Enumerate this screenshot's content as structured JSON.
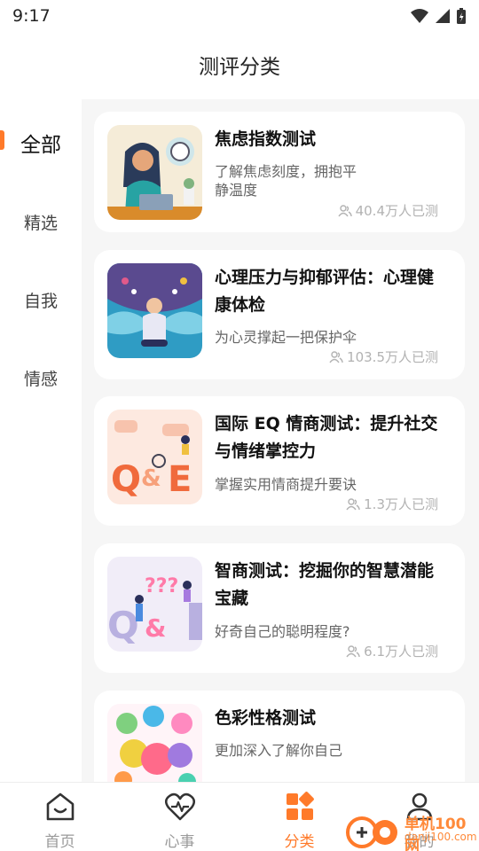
{
  "status_bar": {
    "time": "9:17"
  },
  "header": {
    "title": "测评分类"
  },
  "sidebar": {
    "items": [
      {
        "label": "全部"
      },
      {
        "label": "精选"
      },
      {
        "label": "自我"
      },
      {
        "label": "情感"
      }
    ]
  },
  "cards": [
    {
      "title": "焦虑指数测试",
      "desc": "了解焦虑刻度，拥抱平静温度",
      "count": "40.4万人已测"
    },
    {
      "title": "心理压力与抑郁评估：心理健康体检",
      "desc": "为心灵撑起一把保护伞",
      "count": "103.5万人已测"
    },
    {
      "title": "国际 EQ 情商测试：提升社交与情绪掌控力",
      "desc": "掌握实用情商提升要诀",
      "count": "1.3万人已测"
    },
    {
      "title": "智商测试：挖掘你的智慧潜能宝藏",
      "desc": "好奇自己的聪明程度?",
      "count": "6.1万人已测"
    },
    {
      "title": "色彩性格测试",
      "desc": "更加深入了解你自己",
      "count": ""
    }
  ],
  "tab_bar": {
    "items": [
      {
        "label": "首页"
      },
      {
        "label": "心事"
      },
      {
        "label": "分类"
      },
      {
        "label": "我的"
      }
    ]
  },
  "watermark": {
    "text": "单机100网",
    "sub": "danji100.com"
  },
  "colors": {
    "accent": "#ff7a2a",
    "background": "#f6f6f6",
    "muted": "#b2b2b2"
  }
}
